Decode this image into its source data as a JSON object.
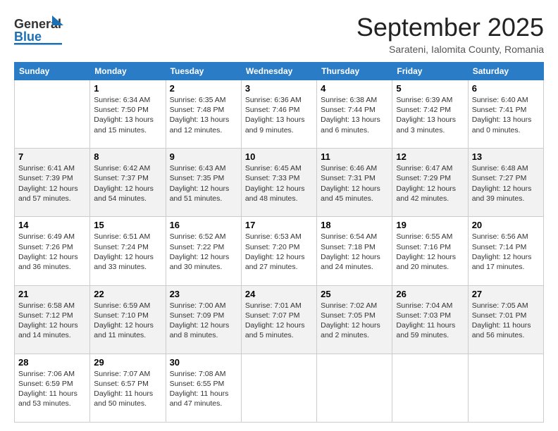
{
  "header": {
    "logo_general": "General",
    "logo_blue": "Blue",
    "month_title": "September 2025",
    "location": "Sarateni, Ialomita County, Romania"
  },
  "days_of_week": [
    "Sunday",
    "Monday",
    "Tuesday",
    "Wednesday",
    "Thursday",
    "Friday",
    "Saturday"
  ],
  "weeks": [
    [
      {
        "day": "",
        "info": ""
      },
      {
        "day": "1",
        "info": "Sunrise: 6:34 AM\nSunset: 7:50 PM\nDaylight: 13 hours\nand 15 minutes."
      },
      {
        "day": "2",
        "info": "Sunrise: 6:35 AM\nSunset: 7:48 PM\nDaylight: 13 hours\nand 12 minutes."
      },
      {
        "day": "3",
        "info": "Sunrise: 6:36 AM\nSunset: 7:46 PM\nDaylight: 13 hours\nand 9 minutes."
      },
      {
        "day": "4",
        "info": "Sunrise: 6:38 AM\nSunset: 7:44 PM\nDaylight: 13 hours\nand 6 minutes."
      },
      {
        "day": "5",
        "info": "Sunrise: 6:39 AM\nSunset: 7:42 PM\nDaylight: 13 hours\nand 3 minutes."
      },
      {
        "day": "6",
        "info": "Sunrise: 6:40 AM\nSunset: 7:41 PM\nDaylight: 13 hours\nand 0 minutes."
      }
    ],
    [
      {
        "day": "7",
        "info": "Sunrise: 6:41 AM\nSunset: 7:39 PM\nDaylight: 12 hours\nand 57 minutes."
      },
      {
        "day": "8",
        "info": "Sunrise: 6:42 AM\nSunset: 7:37 PM\nDaylight: 12 hours\nand 54 minutes."
      },
      {
        "day": "9",
        "info": "Sunrise: 6:43 AM\nSunset: 7:35 PM\nDaylight: 12 hours\nand 51 minutes."
      },
      {
        "day": "10",
        "info": "Sunrise: 6:45 AM\nSunset: 7:33 PM\nDaylight: 12 hours\nand 48 minutes."
      },
      {
        "day": "11",
        "info": "Sunrise: 6:46 AM\nSunset: 7:31 PM\nDaylight: 12 hours\nand 45 minutes."
      },
      {
        "day": "12",
        "info": "Sunrise: 6:47 AM\nSunset: 7:29 PM\nDaylight: 12 hours\nand 42 minutes."
      },
      {
        "day": "13",
        "info": "Sunrise: 6:48 AM\nSunset: 7:27 PM\nDaylight: 12 hours\nand 39 minutes."
      }
    ],
    [
      {
        "day": "14",
        "info": "Sunrise: 6:49 AM\nSunset: 7:26 PM\nDaylight: 12 hours\nand 36 minutes."
      },
      {
        "day": "15",
        "info": "Sunrise: 6:51 AM\nSunset: 7:24 PM\nDaylight: 12 hours\nand 33 minutes."
      },
      {
        "day": "16",
        "info": "Sunrise: 6:52 AM\nSunset: 7:22 PM\nDaylight: 12 hours\nand 30 minutes."
      },
      {
        "day": "17",
        "info": "Sunrise: 6:53 AM\nSunset: 7:20 PM\nDaylight: 12 hours\nand 27 minutes."
      },
      {
        "day": "18",
        "info": "Sunrise: 6:54 AM\nSunset: 7:18 PM\nDaylight: 12 hours\nand 24 minutes."
      },
      {
        "day": "19",
        "info": "Sunrise: 6:55 AM\nSunset: 7:16 PM\nDaylight: 12 hours\nand 20 minutes."
      },
      {
        "day": "20",
        "info": "Sunrise: 6:56 AM\nSunset: 7:14 PM\nDaylight: 12 hours\nand 17 minutes."
      }
    ],
    [
      {
        "day": "21",
        "info": "Sunrise: 6:58 AM\nSunset: 7:12 PM\nDaylight: 12 hours\nand 14 minutes."
      },
      {
        "day": "22",
        "info": "Sunrise: 6:59 AM\nSunset: 7:10 PM\nDaylight: 12 hours\nand 11 minutes."
      },
      {
        "day": "23",
        "info": "Sunrise: 7:00 AM\nSunset: 7:09 PM\nDaylight: 12 hours\nand 8 minutes."
      },
      {
        "day": "24",
        "info": "Sunrise: 7:01 AM\nSunset: 7:07 PM\nDaylight: 12 hours\nand 5 minutes."
      },
      {
        "day": "25",
        "info": "Sunrise: 7:02 AM\nSunset: 7:05 PM\nDaylight: 12 hours\nand 2 minutes."
      },
      {
        "day": "26",
        "info": "Sunrise: 7:04 AM\nSunset: 7:03 PM\nDaylight: 11 hours\nand 59 minutes."
      },
      {
        "day": "27",
        "info": "Sunrise: 7:05 AM\nSunset: 7:01 PM\nDaylight: 11 hours\nand 56 minutes."
      }
    ],
    [
      {
        "day": "28",
        "info": "Sunrise: 7:06 AM\nSunset: 6:59 PM\nDaylight: 11 hours\nand 53 minutes."
      },
      {
        "day": "29",
        "info": "Sunrise: 7:07 AM\nSunset: 6:57 PM\nDaylight: 11 hours\nand 50 minutes."
      },
      {
        "day": "30",
        "info": "Sunrise: 7:08 AM\nSunset: 6:55 PM\nDaylight: 11 hours\nand 47 minutes."
      },
      {
        "day": "",
        "info": ""
      },
      {
        "day": "",
        "info": ""
      },
      {
        "day": "",
        "info": ""
      },
      {
        "day": "",
        "info": ""
      }
    ]
  ]
}
